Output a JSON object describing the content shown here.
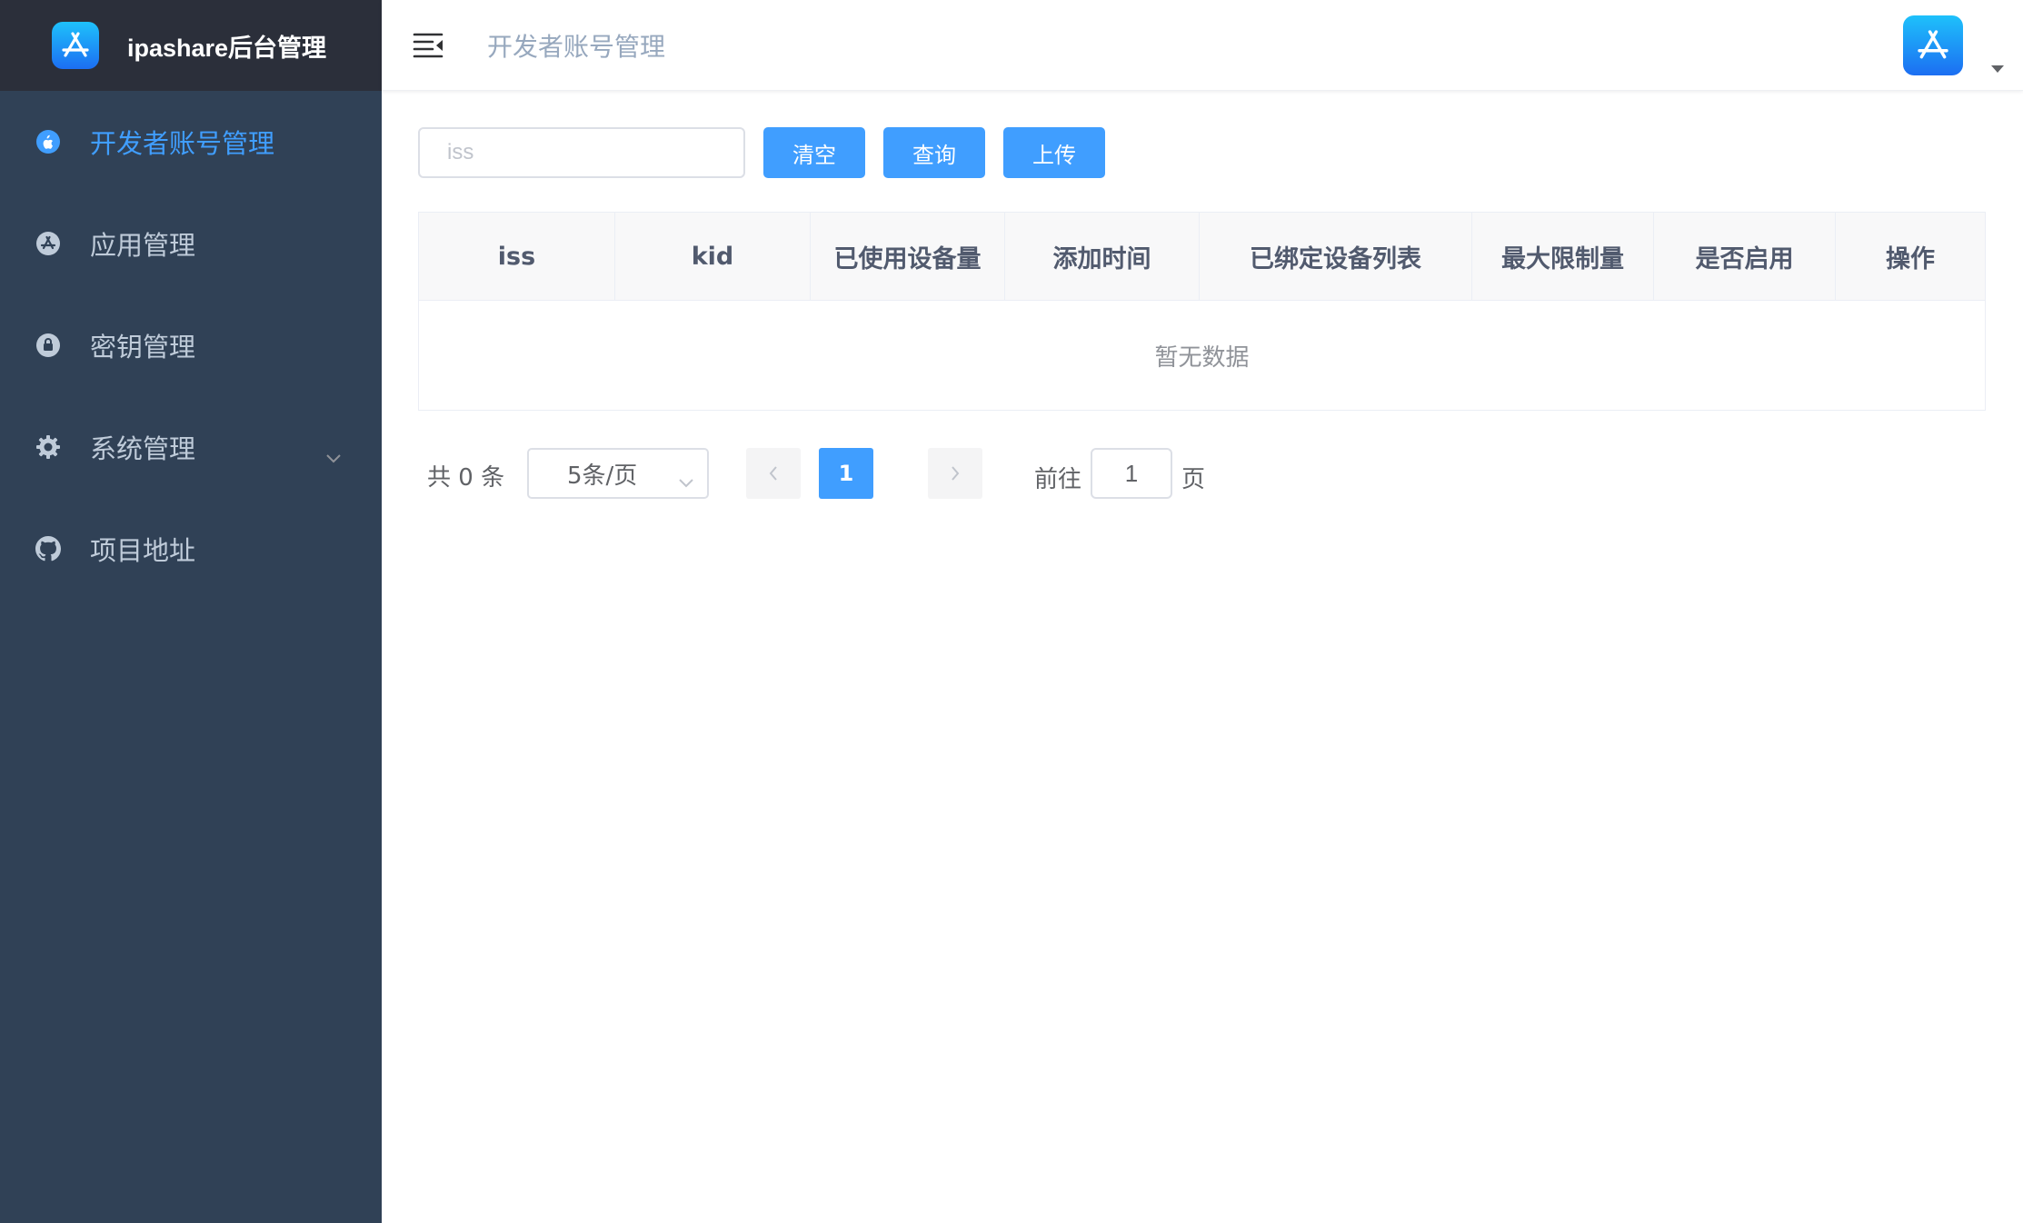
{
  "brand": {
    "title": "ipashare后台管理",
    "logo_icon": "app-store-icon"
  },
  "sidebar": {
    "active_color": "#409eff",
    "items": [
      {
        "label": "开发者账号管理",
        "icon": "apple-icon",
        "active": true
      },
      {
        "label": "应用管理",
        "icon": "app-icon",
        "active": false
      },
      {
        "label": "密钥管理",
        "icon": "lock-icon",
        "active": false
      },
      {
        "label": "系统管理",
        "icon": "gear-icon",
        "active": false,
        "expandable": true
      },
      {
        "label": "项目地址",
        "icon": "github-icon",
        "active": false
      }
    ]
  },
  "header": {
    "breadcrumb": "开发者账号管理",
    "menu_icon": "hamburger-icon",
    "avatar_icon": "app-store-icon"
  },
  "filter": {
    "input_placeholder": "iss",
    "input_value": "",
    "clear_label": "清空",
    "query_label": "查询",
    "upload_label": "上传"
  },
  "table": {
    "columns": [
      "iss",
      "kid",
      "已使用设备量",
      "添加时间",
      "已绑定设备列表",
      "最大限制量",
      "是否启用",
      "操作"
    ],
    "rows": [],
    "empty_text": "暂无数据"
  },
  "pagination": {
    "total_text": "共 0 条",
    "page_size_text": "5条/页",
    "current_page": "1",
    "goto_label": "前往",
    "goto_value": "1",
    "page_unit": "页"
  },
  "colors": {
    "primary": "#409eff",
    "sidebar_bg": "#304156",
    "brand_bg": "#2b2f3a",
    "sidebar_text": "#bfcbd9"
  }
}
